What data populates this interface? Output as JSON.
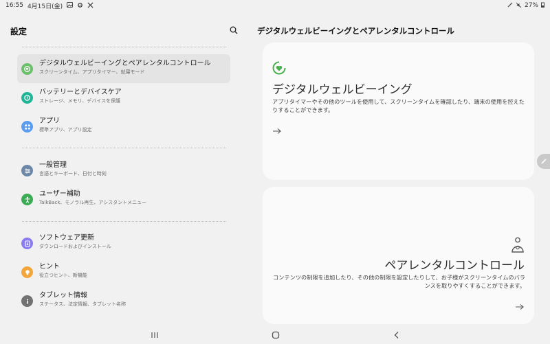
{
  "status_bar": {
    "time": "16:55",
    "date": "4月15日(金)",
    "left_icons": [
      "gallery-icon",
      "gear-icon",
      "tools-icon"
    ],
    "right_icons": [
      "pen-icon",
      "mute-icon"
    ],
    "battery": "27%"
  },
  "left_pane": {
    "title": "設定",
    "items": [
      {
        "label": "デジタルウェルビーイングとペアレンタルコントロール",
        "sub": "スクリーンタイム、アプリタイマー、就寝モード",
        "icon": "digital-wellbeing-icon",
        "color": "#6cc06b",
        "selected": true
      },
      {
        "label": "バッテリーとデバイスケア",
        "sub": "ストレージ、メモリ、デバイスを保護",
        "icon": "device-care-icon",
        "color": "#20b596",
        "selected": false
      },
      {
        "label": "アプリ",
        "sub": "標準アプリ、アプリ設定",
        "icon": "apps-icon",
        "color": "#5a9cf0",
        "selected": false
      },
      {
        "label": "一般管理",
        "sub": "言語とキーボード、日付と時刻",
        "icon": "general-management-icon",
        "color": "#6c87a8",
        "selected": false
      },
      {
        "label": "ユーザー補助",
        "sub": "TalkBack、モノラル再生、アシスタントメニュー",
        "icon": "accessibility-icon",
        "color": "#3cab55",
        "selected": false
      },
      {
        "label": "ソフトウェア更新",
        "sub": "ダウンロードおよびインストール",
        "icon": "software-update-icon",
        "color": "#8a7cf0",
        "selected": false
      },
      {
        "label": "ヒント",
        "sub": "役立つヒント、新機能",
        "icon": "tips-icon",
        "color": "#f4a53c",
        "selected": false
      },
      {
        "label": "タブレット情報",
        "sub": "ステータス、法定情報、タブレット名称",
        "icon": "info-icon",
        "color": "#727272",
        "selected": false
      }
    ]
  },
  "right_pane": {
    "title": "デジタルウェルビーイングとペアレンタルコントロール",
    "card1": {
      "title": "デジタルウェルビーイング",
      "desc": "アプリタイマーやその他のツールを使用して、スクリーンタイムを確認したり、端末の使用を控えたりすることができます。",
      "icon": "wellbeing-heart-icon",
      "accent": "#4caf50"
    },
    "card2": {
      "title": "ペアレンタルコントロール",
      "desc": "コンテンツの制限を追加したり、その他の制限を設定したりして、お子様がスクリーンタイムのバランスを取りやすくすることができます。",
      "icon": "parental-control-icon"
    }
  },
  "navbar": {
    "buttons": [
      "recent-apps-icon",
      "home-icon",
      "back-icon"
    ]
  }
}
